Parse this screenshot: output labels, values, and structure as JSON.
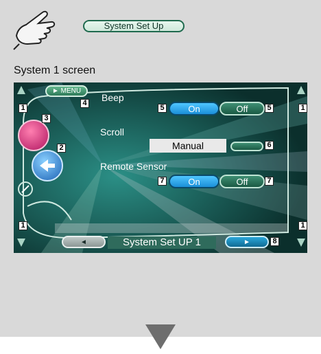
{
  "header": {
    "title_pill": "System Set Up"
  },
  "caption": "System 1 screen",
  "screen": {
    "menu_label": "► MENU",
    "beep": {
      "label": "Beep",
      "on": "On",
      "off": "Off"
    },
    "scroll": {
      "label": "Scroll",
      "value": "Manual"
    },
    "remote": {
      "label": "Remote Sensor",
      "on": "On",
      "off": "Off"
    },
    "bottom": {
      "title": "System Set UP 1",
      "prev": "◄",
      "next": "►"
    }
  },
  "callouts": {
    "n1": "1",
    "n2": "2",
    "n3": "3",
    "n4": "4",
    "n5": "5",
    "n6": "6",
    "n7": "7",
    "n8": "8"
  }
}
